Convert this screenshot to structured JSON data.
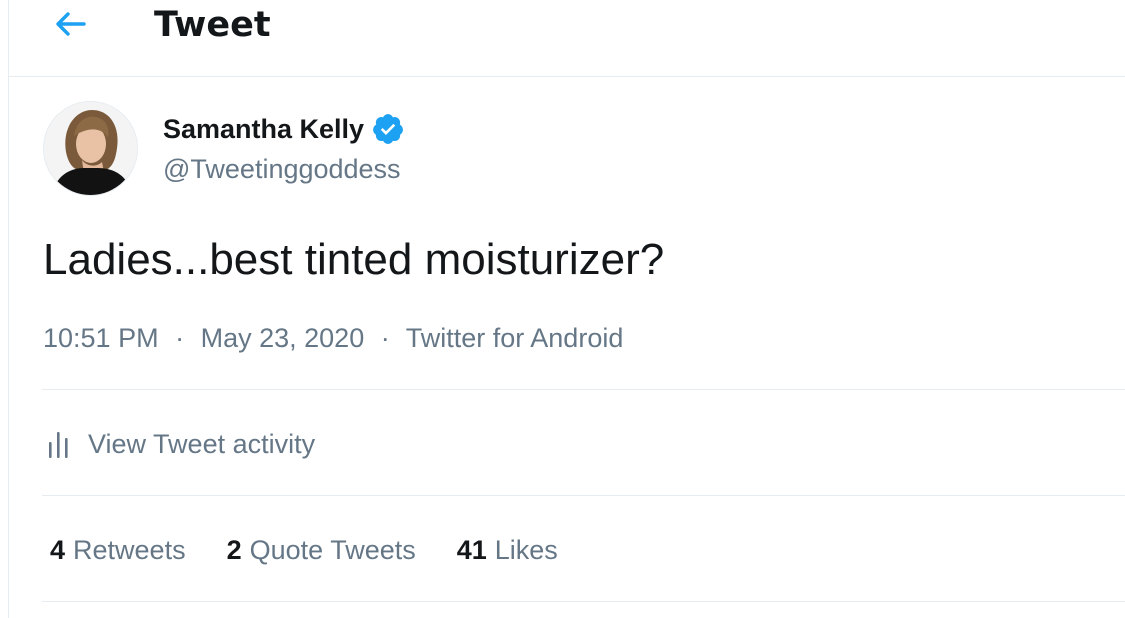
{
  "header": {
    "title": "Tweet",
    "back_icon": "arrow-left-icon"
  },
  "author": {
    "name": "Samantha Kelly",
    "handle": "@Tweetinggoddess",
    "verified_icon": "verified-badge-icon"
  },
  "tweet": {
    "text": "Ladies...best tinted moisturizer?",
    "time": "10:51 PM",
    "date": "May 23, 2020",
    "separator": "·",
    "source": "Twitter for Android"
  },
  "activity": {
    "icon": "bar-chart-icon",
    "label": "View Tweet activity"
  },
  "stats": {
    "retweets_count": "4",
    "retweets_label": "Retweets",
    "quotes_count": "2",
    "quotes_label": "Quote Tweets",
    "likes_count": "41",
    "likes_label": "Likes"
  },
  "colors": {
    "accent": "#1da1f2",
    "text_primary": "#14171a",
    "text_secondary": "#657786",
    "divider": "#e6ecf0"
  }
}
